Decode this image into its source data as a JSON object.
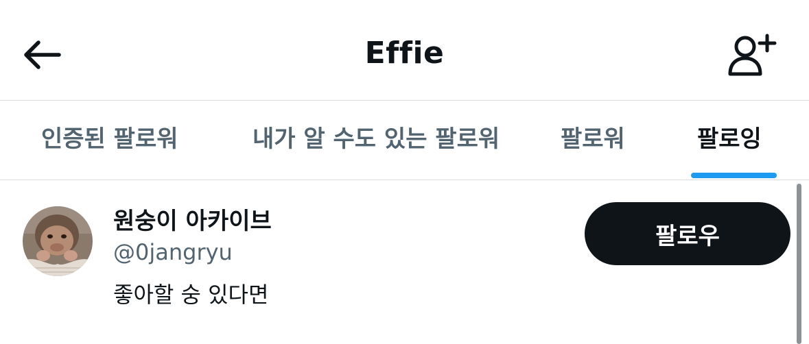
{
  "header": {
    "title": "Effie",
    "back_icon": "arrow-left-icon",
    "add_icon": "person-plus-icon"
  },
  "tabs": [
    {
      "label": "인증된 팔로워",
      "active": false
    },
    {
      "label": "내가 알 수도 있는 팔로워",
      "active": false
    },
    {
      "label": "팔로워",
      "active": false
    },
    {
      "label": "팔로잉",
      "active": true
    }
  ],
  "colors": {
    "accent": "#1d9bf0",
    "text_primary": "#0f1419",
    "text_secondary": "#536471",
    "button_bg": "#0f1419"
  },
  "users": [
    {
      "name": "원숭이 아카이브",
      "handle": "@0jangryu",
      "bio": "좋아할 숭 있다면",
      "follow_label": "팔로우",
      "avatar_icon": "monkey-avatar"
    }
  ]
}
